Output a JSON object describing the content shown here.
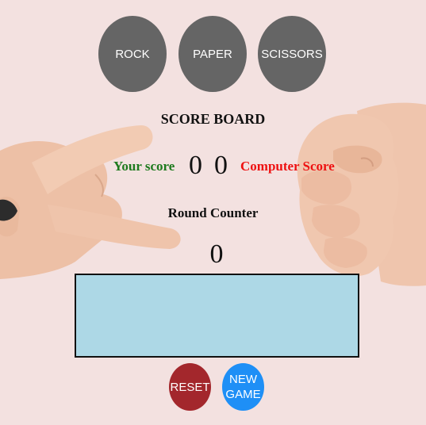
{
  "choices": {
    "rock": "ROCK",
    "paper": "PAPER",
    "scissors": "SCISSORS"
  },
  "scoreboard": {
    "title": "SCORE BOARD",
    "your_label": "Your score",
    "user_score": "0",
    "computer_score": "0",
    "computer_label": "Computer Score"
  },
  "round": {
    "title": "Round Counter",
    "count": "0"
  },
  "result": {
    "text": ""
  },
  "controls": {
    "reset": "RESET",
    "new_game": "NEW\nGAME"
  },
  "colors": {
    "background": "#f3e1e0",
    "choice_button": "#656565",
    "your_label": "#1e7a1e",
    "computer_label": "#ee1111",
    "result_box": "#add8e6",
    "reset_button": "#a3272c",
    "new_game_button": "#1e8ff6"
  },
  "icons": {
    "left_hand": "scissors-hand-icon",
    "right_hand": "rock-fist-icon"
  }
}
